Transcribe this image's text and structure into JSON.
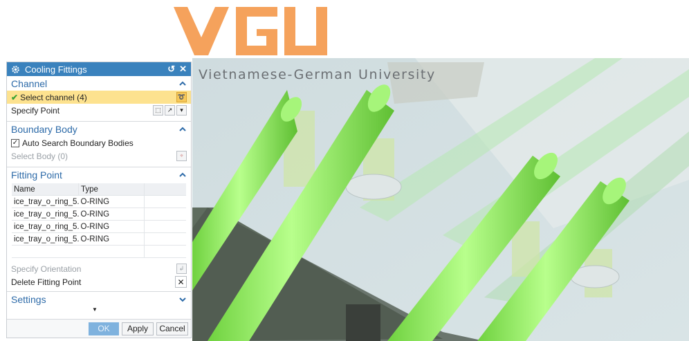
{
  "logo": {
    "letters": "VGU",
    "tagline": "Vietnamese-German University"
  },
  "dialog": {
    "title": "Cooling Fittings",
    "channel": {
      "header": "Channel",
      "select_channel": "Select channel (4)",
      "specify_point": "Specify Point"
    },
    "boundary_body": {
      "header": "Boundary Body",
      "auto_search": "Auto Search Boundary Bodies",
      "auto_search_checked": true,
      "select_body": "Select Body (0)"
    },
    "fitting_point": {
      "header": "Fitting Point",
      "columns": [
        "Name",
        "Type"
      ],
      "rows": [
        [
          "ice_tray_o_ring_5...",
          "O-RING"
        ],
        [
          "ice_tray_o_ring_5...",
          "O-RING"
        ],
        [
          "ice_tray_o_ring_5...",
          "O-RING"
        ],
        [
          "ice_tray_o_ring_5...",
          "O-RING"
        ]
      ],
      "specify_orientation": "Specify Orientation",
      "delete_fitting_point": "Delete Fitting Point"
    },
    "settings": {
      "header": "Settings"
    },
    "buttons": {
      "ok": "OK",
      "apply": "Apply",
      "cancel": "Cancel"
    }
  },
  "colors": {
    "logo_orange": "#f5a25c",
    "title_bar": "#3a82bd",
    "section_header": "#2c6aa8",
    "selected_row": "#fde28f",
    "pipe_green": "#8ee85d",
    "viewport_bg": "#d7e2e6"
  }
}
